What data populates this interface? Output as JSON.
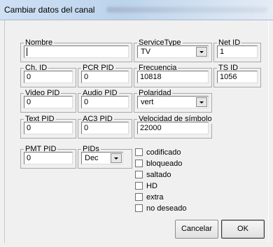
{
  "window": {
    "title": "Cambiar datos del canal"
  },
  "fields": {
    "nombre": {
      "label": "Nombre",
      "value": ""
    },
    "service_type": {
      "label": "ServiceType",
      "value": "TV"
    },
    "net_id": {
      "label": "Net ID",
      "value": "1"
    },
    "ch_id": {
      "label": "Ch. ID",
      "value": "0"
    },
    "pcr_pid": {
      "label": "PCR PID",
      "value": "0"
    },
    "frecuencia": {
      "label": "Frecuencia",
      "value": "10818"
    },
    "ts_id": {
      "label": "TS ID",
      "value": "1056"
    },
    "video_pid": {
      "label": "Video PID",
      "value": "0"
    },
    "audio_pid": {
      "label": "Audio PID",
      "value": "0"
    },
    "polaridad": {
      "label": "Polaridad",
      "value": "vert"
    },
    "text_pid": {
      "label": "Text PID",
      "value": "0"
    },
    "ac3_pid": {
      "label": "AC3 PID",
      "value": "0"
    },
    "velocidad": {
      "label": "Velocidad de símbolo",
      "value": "22000"
    },
    "pmt_pid": {
      "label": "PMT PID",
      "value": "0"
    },
    "pids": {
      "label": "PIDs",
      "value": "Dec"
    }
  },
  "flags": [
    {
      "label": "codificado",
      "checked": false
    },
    {
      "label": "bloqueado",
      "checked": false
    },
    {
      "label": "saltado",
      "checked": false
    },
    {
      "label": "HD",
      "checked": false
    },
    {
      "label": "extra",
      "checked": false
    },
    {
      "label": "no deseado",
      "checked": false
    }
  ],
  "buttons": {
    "cancel": "Cancelar",
    "ok": "OK"
  }
}
